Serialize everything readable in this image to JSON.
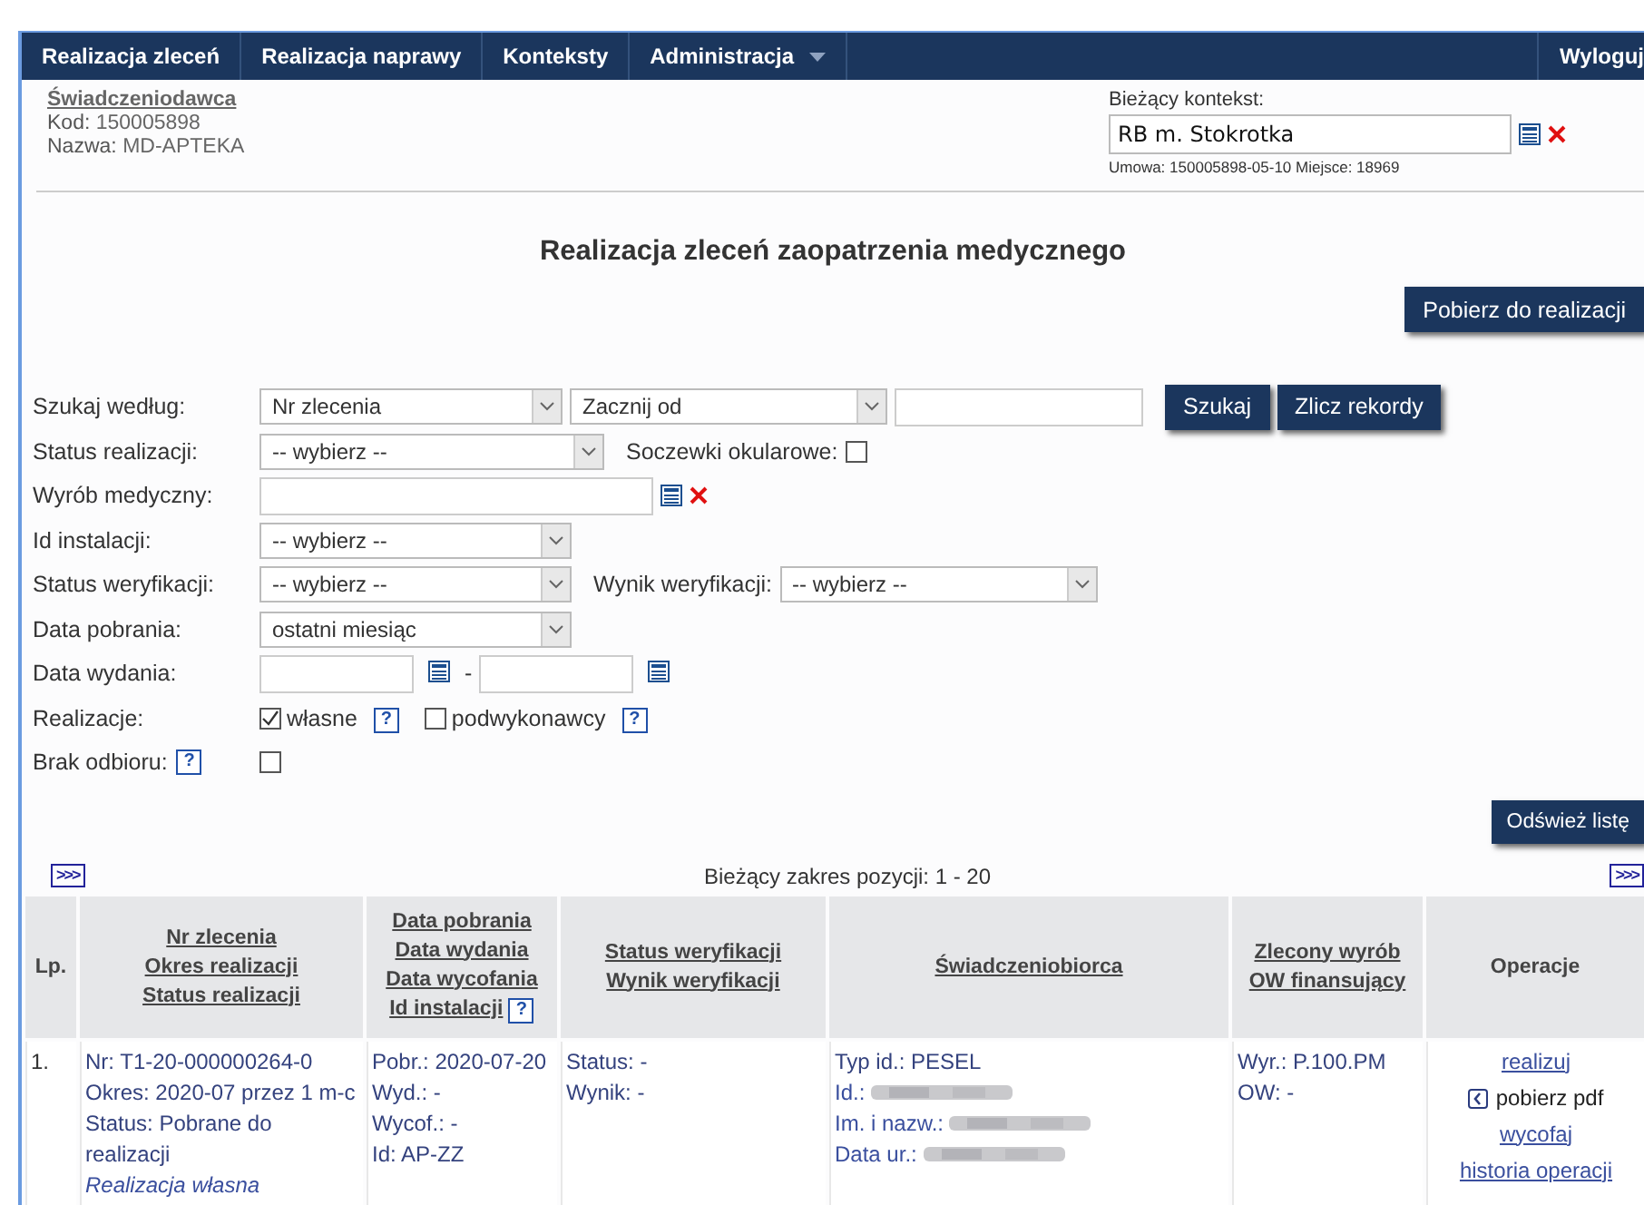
{
  "nav": {
    "items": [
      {
        "label": "Realizacja zleceń",
        "dropdown": false
      },
      {
        "label": "Realizacja naprawy",
        "dropdown": false
      },
      {
        "label": "Konteksty",
        "dropdown": false
      },
      {
        "label": "Administracja",
        "dropdown": true
      }
    ],
    "logout": "Wyloguj"
  },
  "provider": {
    "title": "Świadczeniodawca",
    "fields": [
      {
        "label": "Kod:",
        "value": "150005898"
      },
      {
        "label": "Nazwa:",
        "value": "MD-APTEKA"
      }
    ]
  },
  "context": {
    "label": "Bieżący kontekst:",
    "value": "RB m. Stokrotka",
    "details": "Umowa: 150005898-05-10 Miejsce: 18969"
  },
  "page_title": "Realizacja zleceń zaopatrzenia medycznego",
  "primary_button": "Pobierz do realizacji",
  "search_form": {
    "rows": [
      {
        "label": "Szukaj według:",
        "controls": [
          {
            "kind": "select",
            "value": "Nr zlecenia"
          },
          {
            "kind": "select",
            "value": "Zacznij od"
          },
          {
            "kind": "text"
          },
          {
            "kind": "button",
            "label": "Szukaj"
          },
          {
            "kind": "button",
            "label": "Zlicz rekordy"
          }
        ]
      },
      {
        "label": "Status realizacji:",
        "controls": [
          {
            "kind": "select",
            "value": "-- wybierz --"
          },
          {
            "kind": "label",
            "text": "Soczewki okularowe:"
          },
          {
            "kind": "checkbox",
            "checked": false
          }
        ]
      },
      {
        "label": "Wyrób medyczny:",
        "controls": [
          {
            "kind": "text"
          },
          {
            "kind": "lookup"
          }
        ]
      },
      {
        "label": "Id instalacji:",
        "controls": [
          {
            "kind": "select",
            "value": "-- wybierz --"
          }
        ]
      },
      {
        "label": "Status weryfikacji:",
        "controls": [
          {
            "kind": "select",
            "value": "-- wybierz --"
          },
          {
            "kind": "label",
            "text": "Wynik weryfikacji:"
          },
          {
            "kind": "select",
            "value": "-- wybierz --"
          }
        ]
      },
      {
        "label": "Data pobrania:",
        "controls": [
          {
            "kind": "select",
            "value": "ostatni miesiąc"
          }
        ]
      },
      {
        "label": "Data wydania:",
        "controls": [
          {
            "kind": "text"
          },
          {
            "kind": "calendar"
          },
          {
            "kind": "label",
            "text": "-"
          },
          {
            "kind": "text"
          },
          {
            "kind": "calendar"
          }
        ]
      },
      {
        "label": "Realizacje:",
        "controls": [
          {
            "kind": "checkbox",
            "checked": true,
            "label": "własne",
            "help": "?"
          },
          {
            "kind": "checkbox",
            "checked": false,
            "label": "podwykonawcy",
            "help": "?"
          }
        ]
      },
      {
        "label": "Brak odbioru:",
        "help": "?",
        "controls": [
          {
            "kind": "checkbox",
            "checked": false
          }
        ]
      }
    ]
  },
  "refresh_button": "Odśwież listę",
  "pager": {
    "prev": ">>>",
    "range": "Bieżący zakres pozycji: 1 - 20",
    "next": ">>>"
  },
  "table": {
    "columns": [
      {
        "lines": [
          {
            "text": "Lp.",
            "link": false
          }
        ]
      },
      {
        "lines": [
          {
            "text": "Nr zlecenia",
            "link": true
          },
          {
            "text": "Okres realizacji",
            "link": true
          },
          {
            "text": "Status realizacji",
            "link": true
          }
        ]
      },
      {
        "lines": [
          {
            "text": "Data pobrania",
            "link": true
          },
          {
            "text": "Data wydania",
            "link": true
          },
          {
            "text": "Data wycofania",
            "link": true
          },
          {
            "text": "Id instalacji",
            "link": true,
            "help": "?"
          }
        ]
      },
      {
        "lines": [
          {
            "text": "Status weryfikacji",
            "link": true
          },
          {
            "text": "Wynik weryfikacji",
            "link": true
          }
        ]
      },
      {
        "lines": [
          {
            "text": "Świadczeniobiorca",
            "link": true
          }
        ]
      },
      {
        "lines": [
          {
            "text": "Zlecony wyrób",
            "link": true
          },
          {
            "text": "OW finansujący",
            "link": true
          }
        ]
      },
      {
        "lines": [
          {
            "text": "Operacje",
            "link": false
          }
        ]
      }
    ],
    "rows": [
      {
        "cells": [
          [
            {
              "kind": "text",
              "text": "1."
            }
          ],
          [
            {
              "kind": "field",
              "text": "Nr: T1-20-000000264-0"
            },
            {
              "kind": "field",
              "text": "Okres: 2020-07 przez 1 m-c"
            },
            {
              "kind": "field",
              "text": "Status: Pobrane do realizacji"
            },
            {
              "kind": "note",
              "text": "Realizacja własna"
            }
          ],
          [
            {
              "kind": "field",
              "text": "Pobr.: 2020-07-20"
            },
            {
              "kind": "field",
              "text": "Wyd.: -"
            },
            {
              "kind": "field",
              "text": "Wycof.: -"
            },
            {
              "kind": "field",
              "text": "Id: AP-ZZ"
            }
          ],
          [
            {
              "kind": "field",
              "text": "Status: -"
            },
            {
              "kind": "field",
              "text": "Wynik: -"
            }
          ],
          [
            {
              "kind": "field",
              "text": "Typ id.: PESEL"
            },
            {
              "kind": "redacted",
              "label": "Id.:"
            },
            {
              "kind": "redacted",
              "label": "Im. i nazw.:"
            },
            {
              "kind": "redacted",
              "label": "Data ur.:"
            }
          ],
          [
            {
              "kind": "field",
              "text": "Wyr.: P.100.PM"
            },
            {
              "kind": "field",
              "text": "OW: -"
            }
          ],
          [
            {
              "kind": "link",
              "label": "realizuj"
            },
            {
              "kind": "download",
              "label": "pobierz pdf"
            },
            {
              "kind": "link",
              "label": "wycofaj"
            },
            {
              "kind": "link",
              "label": "historia operacji"
            }
          ]
        ]
      }
    ]
  }
}
